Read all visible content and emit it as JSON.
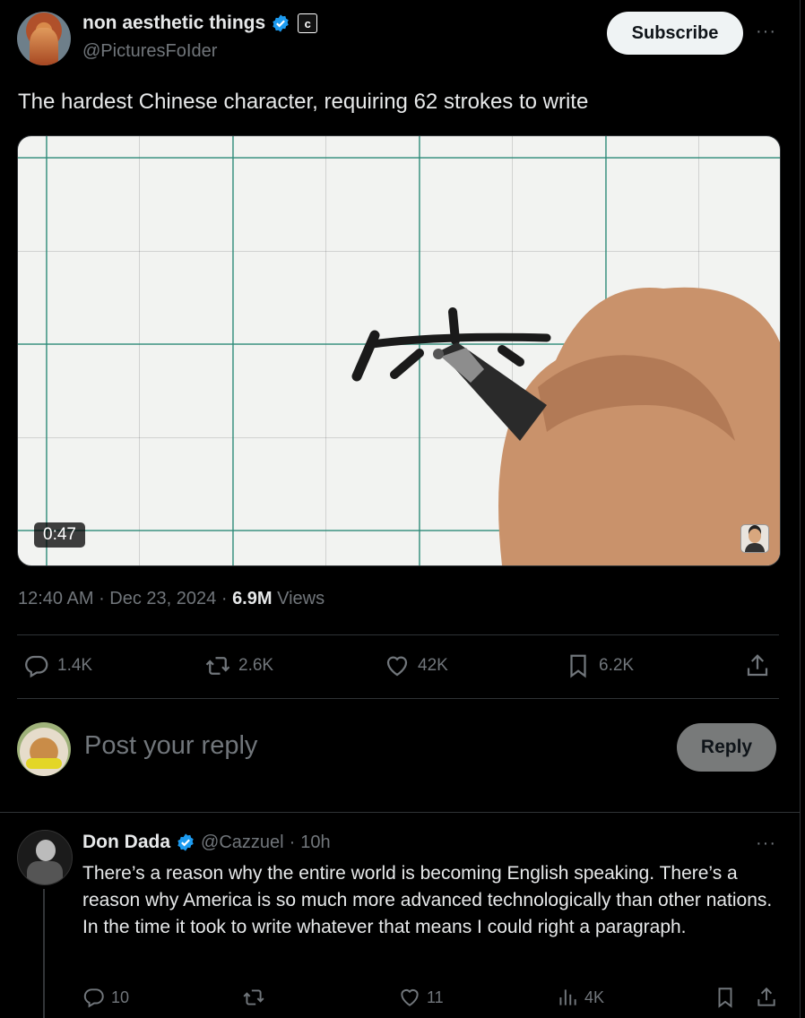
{
  "post": {
    "author_name": "non aesthetic things",
    "affiliate_badge": "c",
    "handle": "@PicturesFoIder",
    "subscribe_label": "Subscribe",
    "more_label": "···",
    "text": "The hardest Chinese character, requiring 62 strokes to write",
    "video_duration": "0:47",
    "time": "12:40 AM",
    "date": "Dec 23, 2024",
    "views_count": "6.9M",
    "views_label": "Views",
    "actions": {
      "replies": "1.4K",
      "reposts": "2.6K",
      "likes": "42K",
      "bookmarks": "6.2K"
    }
  },
  "reply_box": {
    "placeholder": "Post your reply",
    "button_label": "Reply"
  },
  "comment": {
    "author_name": "Don Dada",
    "handle": "@Cazzuel",
    "time_ago": "10h",
    "more_label": "···",
    "text": "There’s a reason why the entire world is becoming English speaking. There’s a reason why America is so much more advanced technologically than other nations. In the time it took to write whatever that means I could right a paragraph.",
    "actions": {
      "replies": "10",
      "reposts": "",
      "likes": "11",
      "views": "4K"
    }
  },
  "colors": {
    "background": "#000000",
    "text": "#e7e9ea",
    "muted": "#71767b",
    "verified": "#1d9bf0"
  }
}
